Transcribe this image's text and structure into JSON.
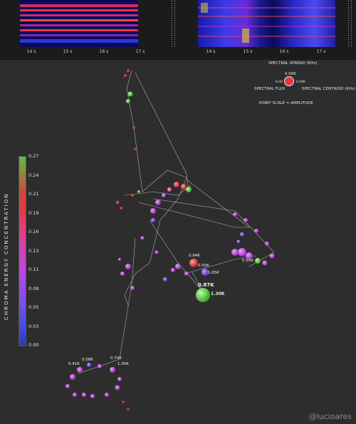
{
  "timeline": {
    "left_ticks": [
      "14 s",
      "15 s",
      "16 s",
      "17 s"
    ],
    "right_ticks": [
      "14 s",
      "15 s",
      "16 s",
      "17 s"
    ]
  },
  "legend": {
    "spread_label": "SPECTRAL SPREAD (KHz)",
    "spread_value": "0.00K",
    "flux_label": "SPECTRAL FLUX",
    "flux_value": "0.00",
    "centroid_label": "SPECTRAL CENTROID (KHz)",
    "centroid_value": "0.00K",
    "scale_note": "POINT SCALE = AMPLITUDE",
    "marker_color": "#e8383b"
  },
  "colorbar": {
    "title": "CHROMA ENERGY CONCENTRATION",
    "ticks": [
      "0.27",
      "0.24",
      "0.21",
      "0.19",
      "0.16",
      "0.13",
      "0.11",
      "0.08",
      "0.05",
      "0.03",
      "0.00"
    ]
  },
  "graph_labels": {
    "l1": "0.94K",
    "l2": "0.50K",
    "l3": "1.65K",
    "l4": "0.50K",
    "l5": "0.87K",
    "l6": "1.30K",
    "l7": "0.74K",
    "l8": "1.00K",
    "l9": "0.41K",
    "l10": "0.08K"
  },
  "watermark": "@lucioares"
}
